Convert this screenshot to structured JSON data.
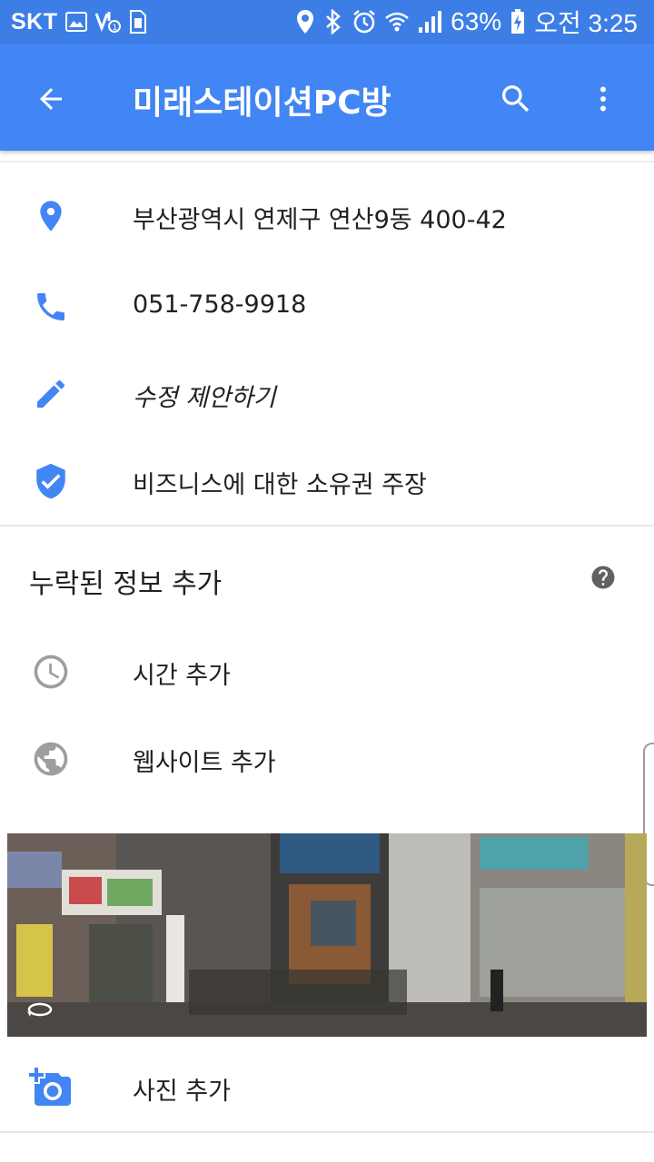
{
  "status_bar": {
    "carrier": "SKT",
    "battery": "63%",
    "time": "오전 3:25"
  },
  "app_bar": {
    "title": "미래스테이션PC방"
  },
  "details": {
    "address": "부산광역시 연제구 연산9동 400-42",
    "phone": "051-758-9918",
    "suggest_edit": "수정 제안하기",
    "claim_business": "비즈니스에 대한 소유권 주장"
  },
  "missing_info": {
    "title": "누락된 정보 추가",
    "add_hours": "시간 추가",
    "add_website": "웹사이트 추가"
  },
  "photos": {
    "add_photo": "사진 추가"
  },
  "colors": {
    "accent": "#4285f4",
    "status_bar": "#3d7ee6",
    "icon_grey": "#9e9e9e"
  },
  "icons": [
    "back-arrow-icon",
    "search-icon",
    "more-vert-icon",
    "location-pin-icon",
    "phone-icon",
    "pencil-icon",
    "shield-check-icon",
    "help-icon",
    "clock-icon",
    "globe-icon",
    "rotate-360-icon",
    "add-photo-icon"
  ]
}
